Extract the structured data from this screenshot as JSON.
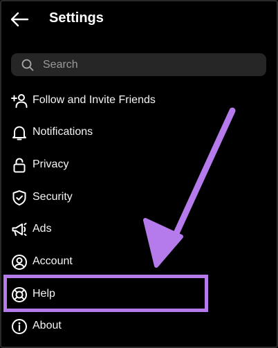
{
  "header": {
    "title": "Settings",
    "back_icon": "back-arrow-icon"
  },
  "search": {
    "placeholder": "Search",
    "value": "",
    "icon": "search-icon"
  },
  "menu": {
    "items": [
      {
        "label": "Follow and Invite Friends",
        "icon": "add-person-icon"
      },
      {
        "label": "Notifications",
        "icon": "bell-icon"
      },
      {
        "label": "Privacy",
        "icon": "lock-icon"
      },
      {
        "label": "Security",
        "icon": "shield-check-icon"
      },
      {
        "label": "Ads",
        "icon": "megaphone-icon"
      },
      {
        "label": "Account",
        "icon": "user-circle-icon"
      },
      {
        "label": "Help",
        "icon": "lifebuoy-icon"
      },
      {
        "label": "About",
        "icon": "info-icon"
      }
    ]
  },
  "annotation": {
    "color": "#b57bec",
    "highlighted_item": "Help"
  },
  "colors": {
    "background": "#000000",
    "search_bg": "#262626",
    "text": "#f5f5f5"
  }
}
